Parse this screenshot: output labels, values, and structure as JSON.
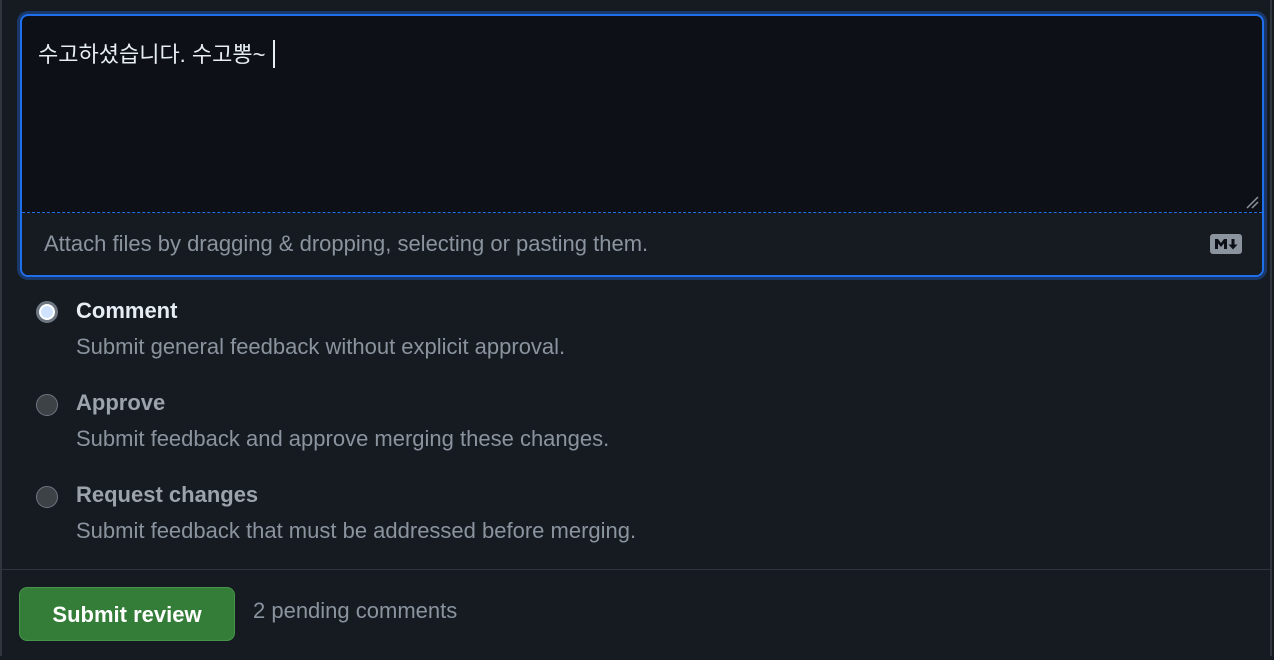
{
  "editor": {
    "text": "수고하셨습니다. 수고뽕~",
    "attach_hint": "Attach files by dragging & dropping, selecting or pasting them.",
    "markdown_icon": "markdown-icon",
    "resize_icon": "resize-grip-icon"
  },
  "review_options": [
    {
      "title": "Comment",
      "description": "Submit general feedback without explicit approval.",
      "selected": true
    },
    {
      "title": "Approve",
      "description": "Submit feedback and approve merging these changes.",
      "selected": false
    },
    {
      "title": "Request changes",
      "description": "Submit feedback that must be addressed before merging.",
      "selected": false
    }
  ],
  "footer": {
    "submit_label": "Submit review",
    "pending_text": "2 pending comments"
  },
  "colors": {
    "background": "#161b22",
    "editor_bg": "#0d1117",
    "focus_border": "#1f6feb",
    "submit_green": "#347d39",
    "muted_text": "#8b949e",
    "primary_text": "#e6edf3"
  }
}
